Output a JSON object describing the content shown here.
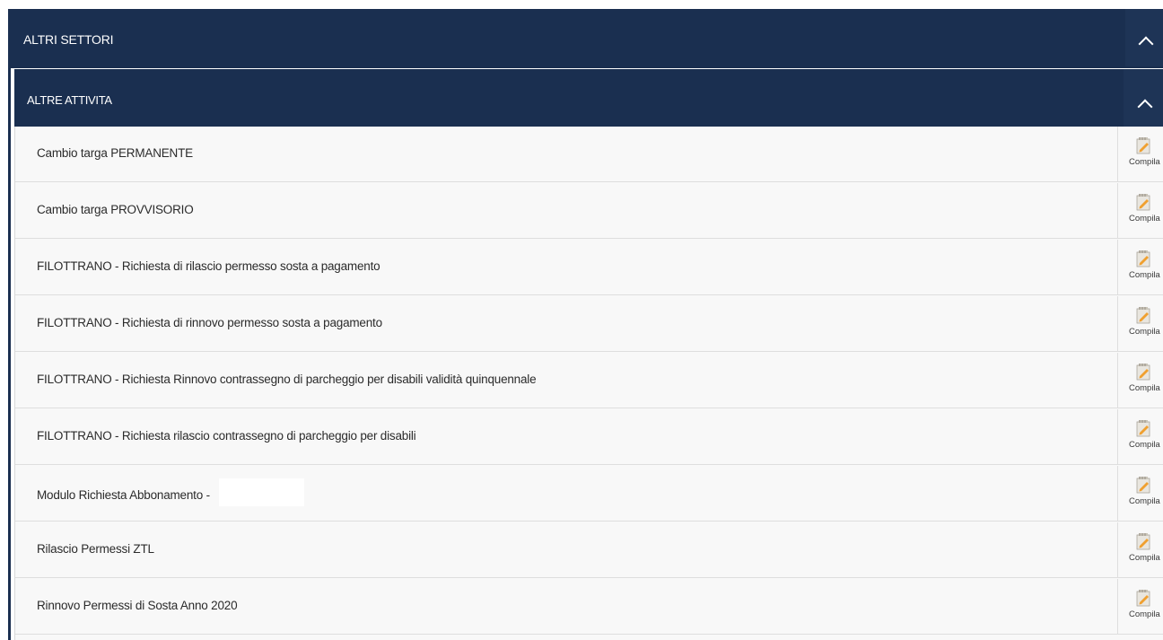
{
  "outer_section": {
    "title": "ALTRI SETTORI",
    "expanded": true
  },
  "inner_section": {
    "title": "ALTRE ATTIVITA",
    "expanded": true
  },
  "action_label": "Compila",
  "action_icon": "edit-document-icon",
  "colors": {
    "header_bg": "#1a2f50",
    "row_bg": "#f8f8f8",
    "icon_pencil": "#f0a030"
  },
  "items": [
    {
      "label": "Cambio targa PERMANENTE"
    },
    {
      "label": "Cambio targa PROVVISORIO"
    },
    {
      "label": "FILOTTRANO - Richiesta di rilascio permesso sosta a pagamento"
    },
    {
      "label": "FILOTTRANO - Richiesta di rinnovo permesso sosta a pagamento"
    },
    {
      "label": "FILOTTRANO - Richiesta Rinnovo contrassegno di parcheggio per disabili validità quinquennale"
    },
    {
      "label": "FILOTTRANO - Richiesta rilascio contrassegno di parcheggio per disabili"
    },
    {
      "label": "Modulo Richiesta Abbonamento -"
    },
    {
      "label": "Rilascio Permessi ZTL"
    },
    {
      "label": "Rinnovo Permessi di Sosta Anno 2020"
    }
  ]
}
